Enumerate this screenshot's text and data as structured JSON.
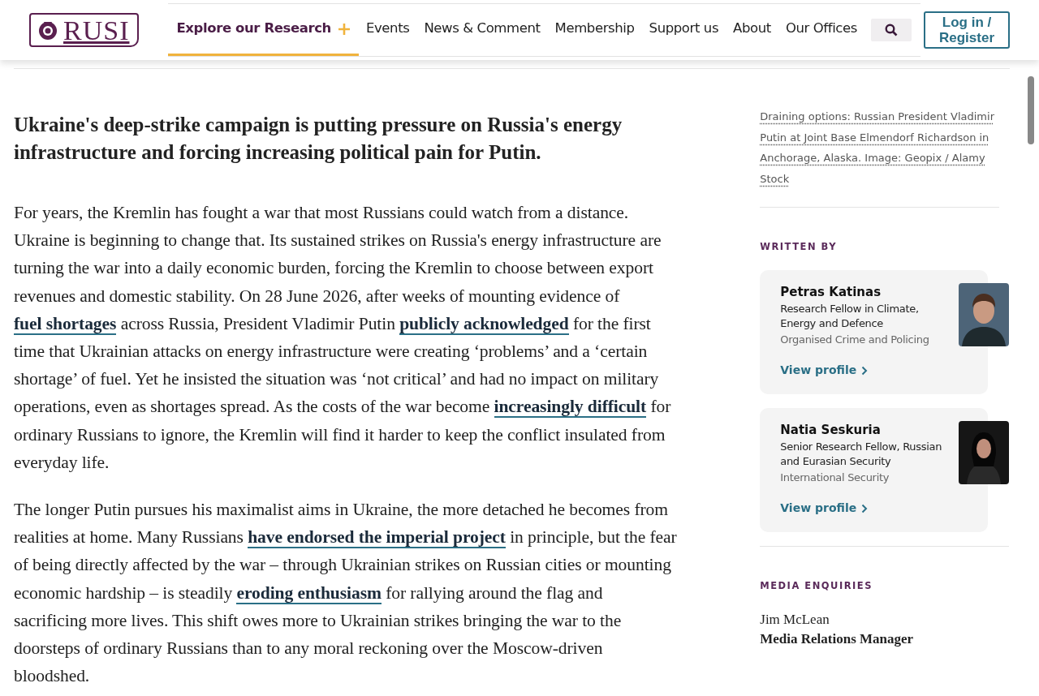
{
  "header": {
    "logo": "RUSI",
    "nav": [
      {
        "label": "Explore our Research",
        "selected": true,
        "expandable": true
      },
      {
        "label": "Events",
        "selected": false,
        "expandable": false
      },
      {
        "label": "News & Comment",
        "selected": false,
        "expandable": false
      },
      {
        "label": "Membership",
        "selected": false,
        "expandable": false
      },
      {
        "label": "Support us",
        "selected": false,
        "expandable": false
      },
      {
        "label": "About",
        "selected": false,
        "expandable": false
      },
      {
        "label": "Our Offices",
        "selected": false,
        "expandable": false
      }
    ],
    "login": "Log in / Register"
  },
  "article": {
    "standfirst": "Ukraine's deep-strike campaign is putting pressure on Russia's energy infrastructure and forcing increasing political pain for Putin.",
    "paragraphs": [
      [
        {
          "kind": "text",
          "text": "For years, the Kremlin has fought a war that most Russians could watch from a distance. Ukraine is beginning to change that. Its sustained strikes on Russia's energy infrastructure are turning the war into a daily economic burden, forcing the Kremlin to choose between export revenues and domestic stability. On 28 June 2026, after weeks of mounting evidence of "
        },
        {
          "kind": "link",
          "text": "fuel shortages"
        },
        {
          "kind": "text",
          "text": " across Russia, President Vladimir Putin "
        },
        {
          "kind": "link",
          "text": "publicly acknowledged"
        },
        {
          "kind": "text",
          "text": " for the first time that Ukrainian attacks on energy infrastructure were creating ‘problems’ and a ‘certain shortage’ of fuel. Yet he insisted the situation was ‘not critical’ and had no impact on military operations, even as shortages spread. As the costs of the war become "
        },
        {
          "kind": "link",
          "text": "increasingly difficult"
        },
        {
          "kind": "text",
          "text": " for ordinary Russians to ignore, the Kremlin will find it harder to keep the conflict insulated from everyday life."
        }
      ],
      [
        {
          "kind": "text",
          "text": "The longer Putin pursues his maximalist aims in Ukraine, the more detached he becomes from realities at home. Many Russians "
        },
        {
          "kind": "link",
          "text": "have endorsed the imperial project"
        },
        {
          "kind": "text",
          "text": " in principle, but the fear of being directly affected by the war – through Ukrainian strikes on Russian cities or mounting economic hardship – is steadily "
        },
        {
          "kind": "link",
          "text": "eroding enthusiasm"
        },
        {
          "kind": "text",
          "text": " for rallying around the flag and sacrificing more lives. This shift owes more to Ukrainian strikes bringing the war to the doorsteps of ordinary Russians than to any moral reckoning over the Moscow-driven bloodshed."
        }
      ]
    ]
  },
  "sidebar": {
    "caption": "Draining options: Russian President Vladimir Putin at Joint Base Elmendorf Richardson in Anchorage, Alaska. Image: Geopix / Alamy Stock",
    "written_by": {
      "heading": "WRITTEN BY",
      "authors": [
        {
          "name": "Petras Katinas",
          "role": "Research Fellow in Climate, Energy and Defence",
          "programme": "Organised Crime and Policing",
          "link": "View profile"
        },
        {
          "name": "Natia Seskuria",
          "role": "Senior Research Fellow, Russian and Eurasian Security",
          "programme": "International Security",
          "link": "View profile"
        }
      ]
    },
    "media": {
      "heading": "MEDIA ENQUIRIES",
      "name": "Jim McLean",
      "title": "Media Relations Manager"
    }
  }
}
